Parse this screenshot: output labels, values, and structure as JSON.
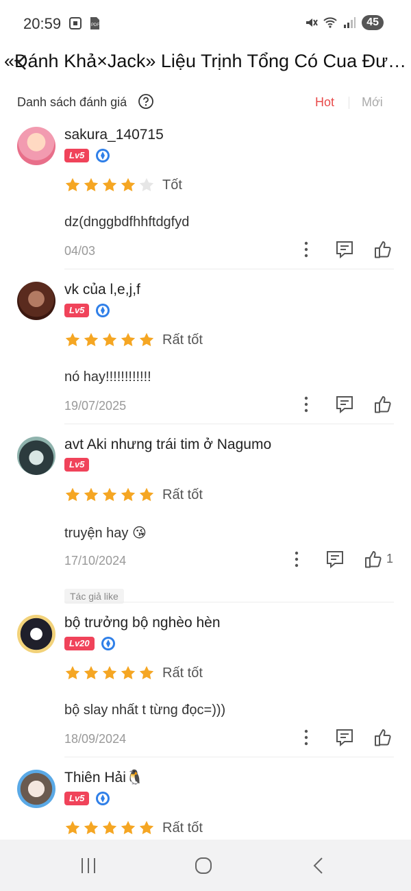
{
  "status_bar": {
    "time": "20:59",
    "battery": "45",
    "left_icons": [
      "screenshot-icon",
      "pdf-icon"
    ],
    "right_icons": [
      "mute-icon",
      "wifi-icon",
      "signal-icon"
    ]
  },
  "title_bar": {
    "title": "«Đánh Khả×Jack» Liệu Trịnh Tổng Có Cua Đư…"
  },
  "list_header": {
    "title": "Danh sách đánh giá",
    "sort_hot": "Hot",
    "sort_new": "Mới",
    "active_color": "#e84a4a"
  },
  "reviews": [
    {
      "username": "sakura_140715",
      "level": "Lv5",
      "vip": true,
      "stars": 4,
      "rating_label": "Tốt",
      "text": "dz(dnggbdfhhftdgfyd",
      "date": "04/03",
      "likes": "",
      "author_liked": false
    },
    {
      "username": "vk của l,e,j,f",
      "level": "Lv5",
      "vip": true,
      "stars": 5,
      "rating_label": "Rất tốt",
      "text": "nó hay!!!!!!!!!!!!",
      "date": "19/07/2025",
      "likes": "",
      "author_liked": false
    },
    {
      "username": "avt Aki nhưng trái tim ở Nagumo",
      "level": "Lv5",
      "vip": false,
      "stars": 5,
      "rating_label": "Rất tốt",
      "text": "truyện hay 😘",
      "date": "17/10/2024",
      "likes": "1",
      "author_liked": true,
      "author_tag": "Tác giả like"
    },
    {
      "username": "bộ trưởng bộ nghèo hèn",
      "level": "Lv20",
      "vip": true,
      "stars": 5,
      "rating_label": "Rất tốt",
      "text": "bộ slay nhất t từng đọc=)))",
      "date": "18/09/2024",
      "likes": "",
      "author_liked": false
    },
    {
      "username": "Thiên Hải🐧",
      "level": "Lv5",
      "vip": true,
      "stars": 5,
      "rating_label": "Rất tốt",
      "text": "",
      "date": "",
      "likes": "",
      "author_liked": false
    }
  ],
  "colors": {
    "star_filled": "#f5a623",
    "star_empty": "#e6e6e6",
    "level_badge": "#f0435a",
    "vip_badge": "#2f7fe8"
  },
  "nav_bar": {
    "icons": [
      "recent-apps-icon",
      "home-icon",
      "back-icon"
    ]
  }
}
